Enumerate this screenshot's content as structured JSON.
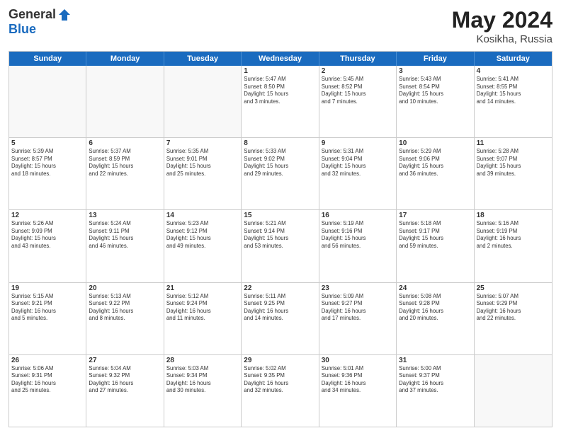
{
  "logo": {
    "general": "General",
    "blue": "Blue"
  },
  "title": {
    "month_year": "May 2024",
    "location": "Kosikha, Russia"
  },
  "header_days": [
    "Sunday",
    "Monday",
    "Tuesday",
    "Wednesday",
    "Thursday",
    "Friday",
    "Saturday"
  ],
  "rows": [
    [
      {
        "day": "",
        "info": ""
      },
      {
        "day": "",
        "info": ""
      },
      {
        "day": "",
        "info": ""
      },
      {
        "day": "1",
        "info": "Sunrise: 5:47 AM\nSunset: 8:50 PM\nDaylight: 15 hours\nand 3 minutes."
      },
      {
        "day": "2",
        "info": "Sunrise: 5:45 AM\nSunset: 8:52 PM\nDaylight: 15 hours\nand 7 minutes."
      },
      {
        "day": "3",
        "info": "Sunrise: 5:43 AM\nSunset: 8:54 PM\nDaylight: 15 hours\nand 10 minutes."
      },
      {
        "day": "4",
        "info": "Sunrise: 5:41 AM\nSunset: 8:55 PM\nDaylight: 15 hours\nand 14 minutes."
      }
    ],
    [
      {
        "day": "5",
        "info": "Sunrise: 5:39 AM\nSunset: 8:57 PM\nDaylight: 15 hours\nand 18 minutes."
      },
      {
        "day": "6",
        "info": "Sunrise: 5:37 AM\nSunset: 8:59 PM\nDaylight: 15 hours\nand 22 minutes."
      },
      {
        "day": "7",
        "info": "Sunrise: 5:35 AM\nSunset: 9:01 PM\nDaylight: 15 hours\nand 25 minutes."
      },
      {
        "day": "8",
        "info": "Sunrise: 5:33 AM\nSunset: 9:02 PM\nDaylight: 15 hours\nand 29 minutes."
      },
      {
        "day": "9",
        "info": "Sunrise: 5:31 AM\nSunset: 9:04 PM\nDaylight: 15 hours\nand 32 minutes."
      },
      {
        "day": "10",
        "info": "Sunrise: 5:29 AM\nSunset: 9:06 PM\nDaylight: 15 hours\nand 36 minutes."
      },
      {
        "day": "11",
        "info": "Sunrise: 5:28 AM\nSunset: 9:07 PM\nDaylight: 15 hours\nand 39 minutes."
      }
    ],
    [
      {
        "day": "12",
        "info": "Sunrise: 5:26 AM\nSunset: 9:09 PM\nDaylight: 15 hours\nand 43 minutes."
      },
      {
        "day": "13",
        "info": "Sunrise: 5:24 AM\nSunset: 9:11 PM\nDaylight: 15 hours\nand 46 minutes."
      },
      {
        "day": "14",
        "info": "Sunrise: 5:23 AM\nSunset: 9:12 PM\nDaylight: 15 hours\nand 49 minutes."
      },
      {
        "day": "15",
        "info": "Sunrise: 5:21 AM\nSunset: 9:14 PM\nDaylight: 15 hours\nand 53 minutes."
      },
      {
        "day": "16",
        "info": "Sunrise: 5:19 AM\nSunset: 9:16 PM\nDaylight: 15 hours\nand 56 minutes."
      },
      {
        "day": "17",
        "info": "Sunrise: 5:18 AM\nSunset: 9:17 PM\nDaylight: 15 hours\nand 59 minutes."
      },
      {
        "day": "18",
        "info": "Sunrise: 5:16 AM\nSunset: 9:19 PM\nDaylight: 16 hours\nand 2 minutes."
      }
    ],
    [
      {
        "day": "19",
        "info": "Sunrise: 5:15 AM\nSunset: 9:21 PM\nDaylight: 16 hours\nand 5 minutes."
      },
      {
        "day": "20",
        "info": "Sunrise: 5:13 AM\nSunset: 9:22 PM\nDaylight: 16 hours\nand 8 minutes."
      },
      {
        "day": "21",
        "info": "Sunrise: 5:12 AM\nSunset: 9:24 PM\nDaylight: 16 hours\nand 11 minutes."
      },
      {
        "day": "22",
        "info": "Sunrise: 5:11 AM\nSunset: 9:25 PM\nDaylight: 16 hours\nand 14 minutes."
      },
      {
        "day": "23",
        "info": "Sunrise: 5:09 AM\nSunset: 9:27 PM\nDaylight: 16 hours\nand 17 minutes."
      },
      {
        "day": "24",
        "info": "Sunrise: 5:08 AM\nSunset: 9:28 PM\nDaylight: 16 hours\nand 20 minutes."
      },
      {
        "day": "25",
        "info": "Sunrise: 5:07 AM\nSunset: 9:29 PM\nDaylight: 16 hours\nand 22 minutes."
      }
    ],
    [
      {
        "day": "26",
        "info": "Sunrise: 5:06 AM\nSunset: 9:31 PM\nDaylight: 16 hours\nand 25 minutes."
      },
      {
        "day": "27",
        "info": "Sunrise: 5:04 AM\nSunset: 9:32 PM\nDaylight: 16 hours\nand 27 minutes."
      },
      {
        "day": "28",
        "info": "Sunrise: 5:03 AM\nSunset: 9:34 PM\nDaylight: 16 hours\nand 30 minutes."
      },
      {
        "day": "29",
        "info": "Sunrise: 5:02 AM\nSunset: 9:35 PM\nDaylight: 16 hours\nand 32 minutes."
      },
      {
        "day": "30",
        "info": "Sunrise: 5:01 AM\nSunset: 9:36 PM\nDaylight: 16 hours\nand 34 minutes."
      },
      {
        "day": "31",
        "info": "Sunrise: 5:00 AM\nSunset: 9:37 PM\nDaylight: 16 hours\nand 37 minutes."
      },
      {
        "day": "",
        "info": ""
      }
    ]
  ]
}
